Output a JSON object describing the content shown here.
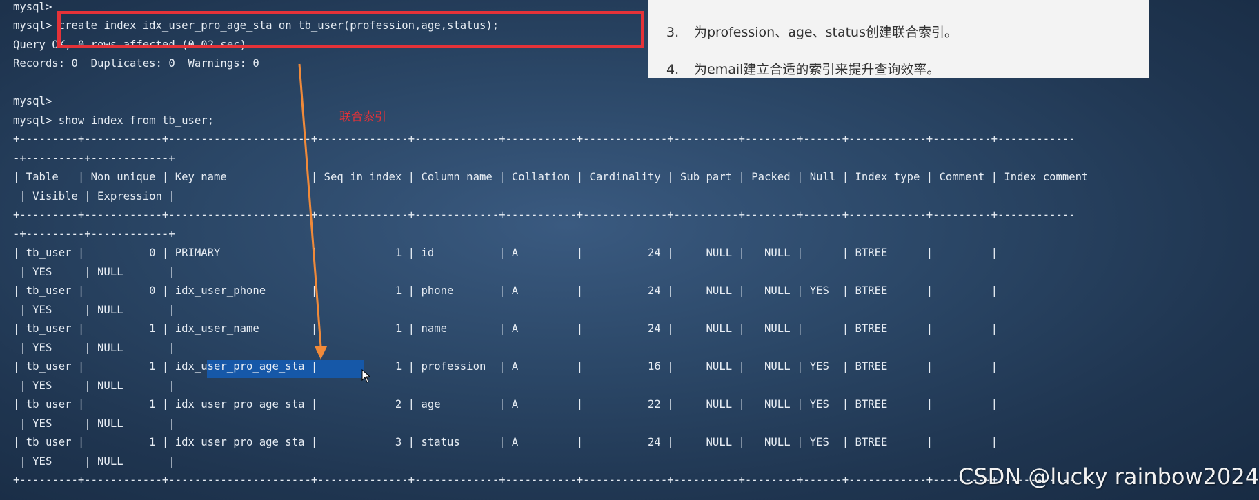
{
  "terminal": {
    "lines": [
      "mysql>",
      "mysql> create index idx_user_pro_age_sta on tb_user(profession,age,status);",
      "Query OK, 0 rows affected (0.02 sec)",
      "Records: 0  Duplicates: 0  Warnings: 0",
      "",
      "mysql>",
      "mysql> show index from tb_user;",
      "+---------+------------+----------------------+--------------+-------------+-----------+-------------+----------+--------+------+------------+---------+------------",
      "-+---------+------------+",
      "| Table   | Non_unique | Key_name             | Seq_in_index | Column_name | Collation | Cardinality | Sub_part | Packed | Null | Index_type | Comment | Index_comment",
      " | Visible | Expression |",
      "+---------+------------+----------------------+--------------+-------------+-----------+-------------+----------+--------+------+------------+---------+------------",
      "-+---------+------------+",
      "| tb_user |          0 | PRIMARY              |            1 | id          | A         |          24 |     NULL |   NULL |      | BTREE      |         |",
      " | YES     | NULL       |",
      "| tb_user |          0 | idx_user_phone       |            1 | phone       | A         |          24 |     NULL |   NULL | YES  | BTREE      |         |",
      " | YES     | NULL       |",
      "| tb_user |          1 | idx_user_name        |            1 | name        | A         |          24 |     NULL |   NULL |      | BTREE      |         |",
      " | YES     | NULL       |",
      "| tb_user |          1 | idx_user_pro_age_sta |            1 | profession  | A         |          16 |     NULL |   NULL | YES  | BTREE      |         |",
      " | YES     | NULL       |",
      "| tb_user |          1 | idx_user_pro_age_sta |            2 | age         | A         |          22 |     NULL |   NULL | YES  | BTREE      |         |",
      " | YES     | NULL       |",
      "| tb_user |          1 | idx_user_pro_age_sta |            3 | status      | A         |          24 |     NULL |   NULL | YES  | BTREE      |         |",
      " | YES     | NULL       |",
      "+---------+------------+----------------------+--------------+-------------+-----------+-------------+----------+--------+------+------------+---------+------------"
    ]
  },
  "slide": {
    "items": [
      {
        "num": "3.",
        "text": "为profession、age、status创建联合索引。"
      },
      {
        "num": "4.",
        "text": "为email建立合适的索引来提升查询效率。"
      }
    ]
  },
  "annotation": {
    "label": "联合索引"
  },
  "watermark": {
    "text": "CSDN @lucky rainbow2024"
  },
  "colors": {
    "highlight_box": "#e53238",
    "arrow": "#f08a3a",
    "selection": "#1658a8",
    "terminal_text": "#e6ecf3"
  }
}
